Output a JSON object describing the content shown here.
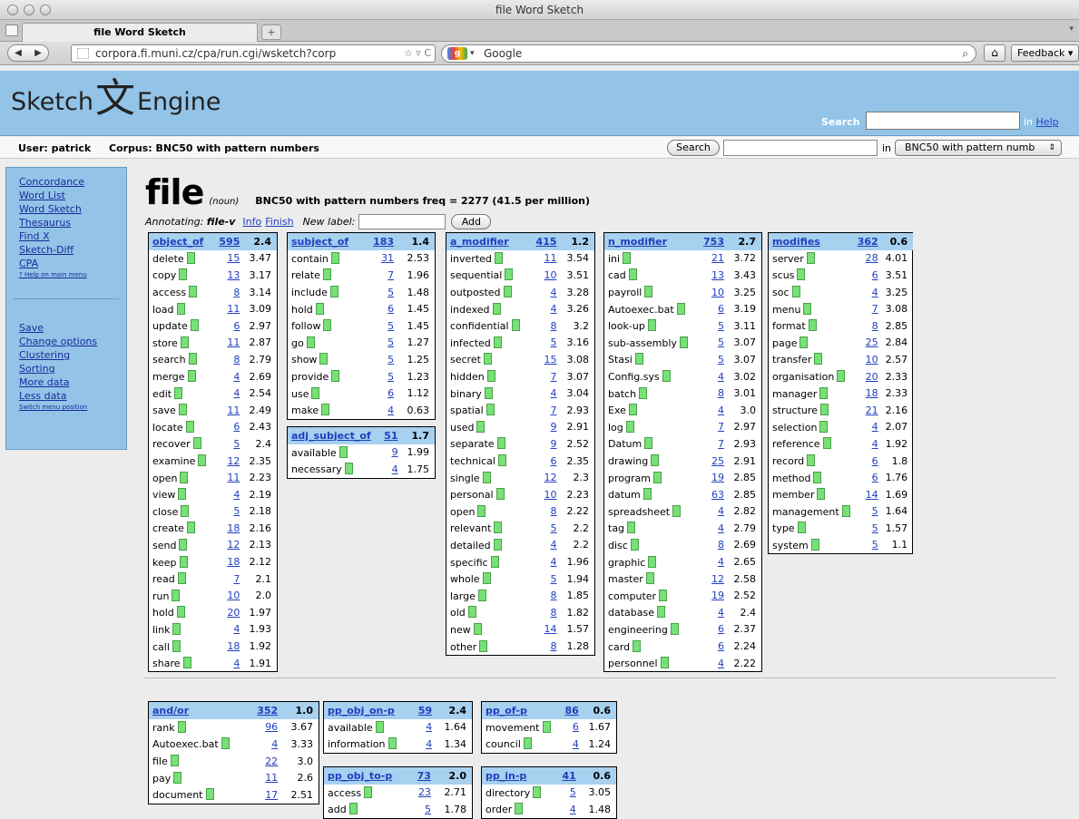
{
  "browser": {
    "window_title": "file Word Sketch",
    "tab_title": "file Word Sketch",
    "new_tab": "+",
    "url": "corpora.fi.muni.cz/cpa/run.cgi/wsketch?corp",
    "search_engine": "Google",
    "feedback_label": "Feedback"
  },
  "header": {
    "logo_left": "Sketch",
    "logo_glyph": "文",
    "logo_right": "Engine",
    "search_label": "Search",
    "help_prefix": "in",
    "help_link": "Help"
  },
  "userbar": {
    "user": "User: patrick",
    "corpus": "Corpus: BNC50 with pattern numbers",
    "search_button": "Search",
    "in_label": "in",
    "corpus_select": "BNC50 with pattern numb"
  },
  "sidebar": {
    "links_top": [
      "Concordance",
      "Word List",
      "Word Sketch",
      "Thesaurus",
      "Find X",
      "Sketch-Diff",
      "CPA"
    ],
    "help_link": "? Help on main menu",
    "links_bottom": [
      "Save",
      "Change options",
      "Clustering",
      "Sorting",
      "More data",
      "Less data"
    ],
    "switch_link": "Switch menu position"
  },
  "main": {
    "headword": "file",
    "pos": "(noun)",
    "freq_text": "BNC50 with pattern numbers freq = 2277 (41.5 per million)",
    "annotating_label": "Annotating:",
    "annotating_value": "file-v",
    "info_link": "Info",
    "finish_link": "Finish",
    "new_label": "New label:",
    "add_button": "Add"
  },
  "grammar_relations": [
    {
      "name": "object_of",
      "count": "595",
      "score": "2.4",
      "rows": [
        [
          "delete",
          "15",
          "3.47"
        ],
        [
          "copy",
          "13",
          "3.17"
        ],
        [
          "access",
          "8",
          "3.14"
        ],
        [
          "load",
          "11",
          "3.09"
        ],
        [
          "update",
          "6",
          "2.97"
        ],
        [
          "store",
          "11",
          "2.87"
        ],
        [
          "search",
          "8",
          "2.79"
        ],
        [
          "merge",
          "4",
          "2.69"
        ],
        [
          "edit",
          "4",
          "2.54"
        ],
        [
          "save",
          "11",
          "2.49"
        ],
        [
          "locate",
          "6",
          "2.43"
        ],
        [
          "recover",
          "5",
          "2.4"
        ],
        [
          "examine",
          "12",
          "2.35"
        ],
        [
          "open",
          "11",
          "2.23"
        ],
        [
          "view",
          "4",
          "2.19"
        ],
        [
          "close",
          "5",
          "2.18"
        ],
        [
          "create",
          "18",
          "2.16"
        ],
        [
          "send",
          "12",
          "2.13"
        ],
        [
          "keep",
          "18",
          "2.12"
        ],
        [
          "read",
          "7",
          "2.1"
        ],
        [
          "run",
          "10",
          "2.0"
        ],
        [
          "hold",
          "20",
          "1.97"
        ],
        [
          "link",
          "4",
          "1.93"
        ],
        [
          "call",
          "18",
          "1.92"
        ],
        [
          "share",
          "4",
          "1.91"
        ]
      ]
    },
    {
      "name": "subject_of",
      "count": "183",
      "score": "1.4",
      "rows": [
        [
          "contain",
          "31",
          "2.53"
        ],
        [
          "relate",
          "7",
          "1.96"
        ],
        [
          "include",
          "5",
          "1.48"
        ],
        [
          "hold",
          "6",
          "1.45"
        ],
        [
          "follow",
          "5",
          "1.45"
        ],
        [
          "go",
          "5",
          "1.27"
        ],
        [
          "show",
          "5",
          "1.25"
        ],
        [
          "provide",
          "5",
          "1.23"
        ],
        [
          "use",
          "6",
          "1.12"
        ],
        [
          "make",
          "4",
          "0.63"
        ]
      ]
    },
    {
      "name": "adj_subject_of",
      "count": "51",
      "score": "1.7",
      "rows": [
        [
          "available",
          "9",
          "1.99"
        ],
        [
          "necessary",
          "4",
          "1.75"
        ]
      ]
    },
    {
      "name": "a_modifier",
      "count": "415",
      "score": "1.2",
      "rows": [
        [
          "inverted",
          "11",
          "3.54"
        ],
        [
          "sequential",
          "10",
          "3.51"
        ],
        [
          "outposted",
          "4",
          "3.28"
        ],
        [
          "indexed",
          "4",
          "3.26"
        ],
        [
          "confidential",
          "8",
          "3.2"
        ],
        [
          "infected",
          "5",
          "3.16"
        ],
        [
          "secret",
          "15",
          "3.08"
        ],
        [
          "hidden",
          "7",
          "3.07"
        ],
        [
          "binary",
          "4",
          "3.04"
        ],
        [
          "spatial",
          "7",
          "2.93"
        ],
        [
          "used",
          "9",
          "2.91"
        ],
        [
          "separate",
          "9",
          "2.52"
        ],
        [
          "technical",
          "6",
          "2.35"
        ],
        [
          "single",
          "12",
          "2.3"
        ],
        [
          "personal",
          "10",
          "2.23"
        ],
        [
          "open",
          "8",
          "2.22"
        ],
        [
          "relevant",
          "5",
          "2.2"
        ],
        [
          "detailed",
          "4",
          "2.2"
        ],
        [
          "specific",
          "4",
          "1.96"
        ],
        [
          "whole",
          "5",
          "1.94"
        ],
        [
          "large",
          "8",
          "1.85"
        ],
        [
          "old",
          "8",
          "1.82"
        ],
        [
          "new",
          "14",
          "1.57"
        ],
        [
          "other",
          "8",
          "1.28"
        ]
      ]
    },
    {
      "name": "n_modifier",
      "count": "753",
      "score": "2.7",
      "rows": [
        [
          "ini",
          "21",
          "3.72"
        ],
        [
          "cad",
          "13",
          "3.43"
        ],
        [
          "payroll",
          "10",
          "3.25"
        ],
        [
          "Autoexec.bat",
          "6",
          "3.19"
        ],
        [
          "look-up",
          "5",
          "3.11"
        ],
        [
          "sub-assembly",
          "5",
          "3.07"
        ],
        [
          "Stasi",
          "5",
          "3.07"
        ],
        [
          "Config.sys",
          "4",
          "3.02"
        ],
        [
          "batch",
          "8",
          "3.01"
        ],
        [
          "Exe",
          "4",
          "3.0"
        ],
        [
          "log",
          "7",
          "2.97"
        ],
        [
          "Datum",
          "7",
          "2.93"
        ],
        [
          "drawing",
          "25",
          "2.91"
        ],
        [
          "program",
          "19",
          "2.85"
        ],
        [
          "datum",
          "63",
          "2.85"
        ],
        [
          "spreadsheet",
          "4",
          "2.82"
        ],
        [
          "tag",
          "4",
          "2.79"
        ],
        [
          "disc",
          "8",
          "2.69"
        ],
        [
          "graphic",
          "4",
          "2.65"
        ],
        [
          "master",
          "12",
          "2.58"
        ],
        [
          "computer",
          "19",
          "2.52"
        ],
        [
          "database",
          "4",
          "2.4"
        ],
        [
          "engineering",
          "6",
          "2.37"
        ],
        [
          "card",
          "6",
          "2.24"
        ],
        [
          "personnel",
          "4",
          "2.22"
        ]
      ]
    },
    {
      "name": "modifies",
      "count": "362",
      "score": "0.6",
      "rows": [
        [
          "server",
          "28",
          "4.01"
        ],
        [
          "scus",
          "6",
          "3.51"
        ],
        [
          "soc",
          "4",
          "3.25"
        ],
        [
          "menu",
          "7",
          "3.08"
        ],
        [
          "format",
          "8",
          "2.85"
        ],
        [
          "page",
          "25",
          "2.84"
        ],
        [
          "transfer",
          "10",
          "2.57"
        ],
        [
          "organisation",
          "20",
          "2.33"
        ],
        [
          "manager",
          "18",
          "2.33"
        ],
        [
          "structure",
          "21",
          "2.16"
        ],
        [
          "selection",
          "4",
          "2.07"
        ],
        [
          "reference",
          "4",
          "1.92"
        ],
        [
          "record",
          "6",
          "1.8"
        ],
        [
          "method",
          "6",
          "1.76"
        ],
        [
          "member",
          "14",
          "1.69"
        ],
        [
          "management",
          "5",
          "1.64"
        ],
        [
          "type",
          "5",
          "1.57"
        ],
        [
          "system",
          "5",
          "1.1"
        ]
      ]
    },
    {
      "name": "and/or",
      "count": "352",
      "score": "1.0",
      "rows": [
        [
          "rank",
          "96",
          "3.67"
        ],
        [
          "Autoexec.bat",
          "4",
          "3.33"
        ],
        [
          "file",
          "22",
          "3.0"
        ],
        [
          "pay",
          "11",
          "2.6"
        ],
        [
          "document",
          "17",
          "2.51"
        ]
      ]
    },
    {
      "name": "pp_obj_on-p",
      "count": "59",
      "score": "2.4",
      "rows": [
        [
          "available",
          "4",
          "1.64"
        ],
        [
          "information",
          "4",
          "1.34"
        ]
      ]
    },
    {
      "name": "pp_obj_to-p",
      "count": "73",
      "score": "2.0",
      "rows": [
        [
          "access",
          "23",
          "2.71"
        ],
        [
          "add",
          "5",
          "1.78"
        ]
      ]
    },
    {
      "name": "pp_of-p",
      "count": "86",
      "score": "0.6",
      "rows": [
        [
          "movement",
          "6",
          "1.67"
        ],
        [
          "council",
          "4",
          "1.24"
        ]
      ]
    },
    {
      "name": "pp_in-p",
      "count": "41",
      "score": "0.6",
      "rows": [
        [
          "directory",
          "5",
          "3.05"
        ],
        [
          "order",
          "4",
          "1.48"
        ]
      ]
    }
  ],
  "colors": {
    "header_blue": "#93c4e8",
    "table_header": "#a8d0ef",
    "bar_green": "#77e077",
    "link": "#1f3fbf"
  }
}
